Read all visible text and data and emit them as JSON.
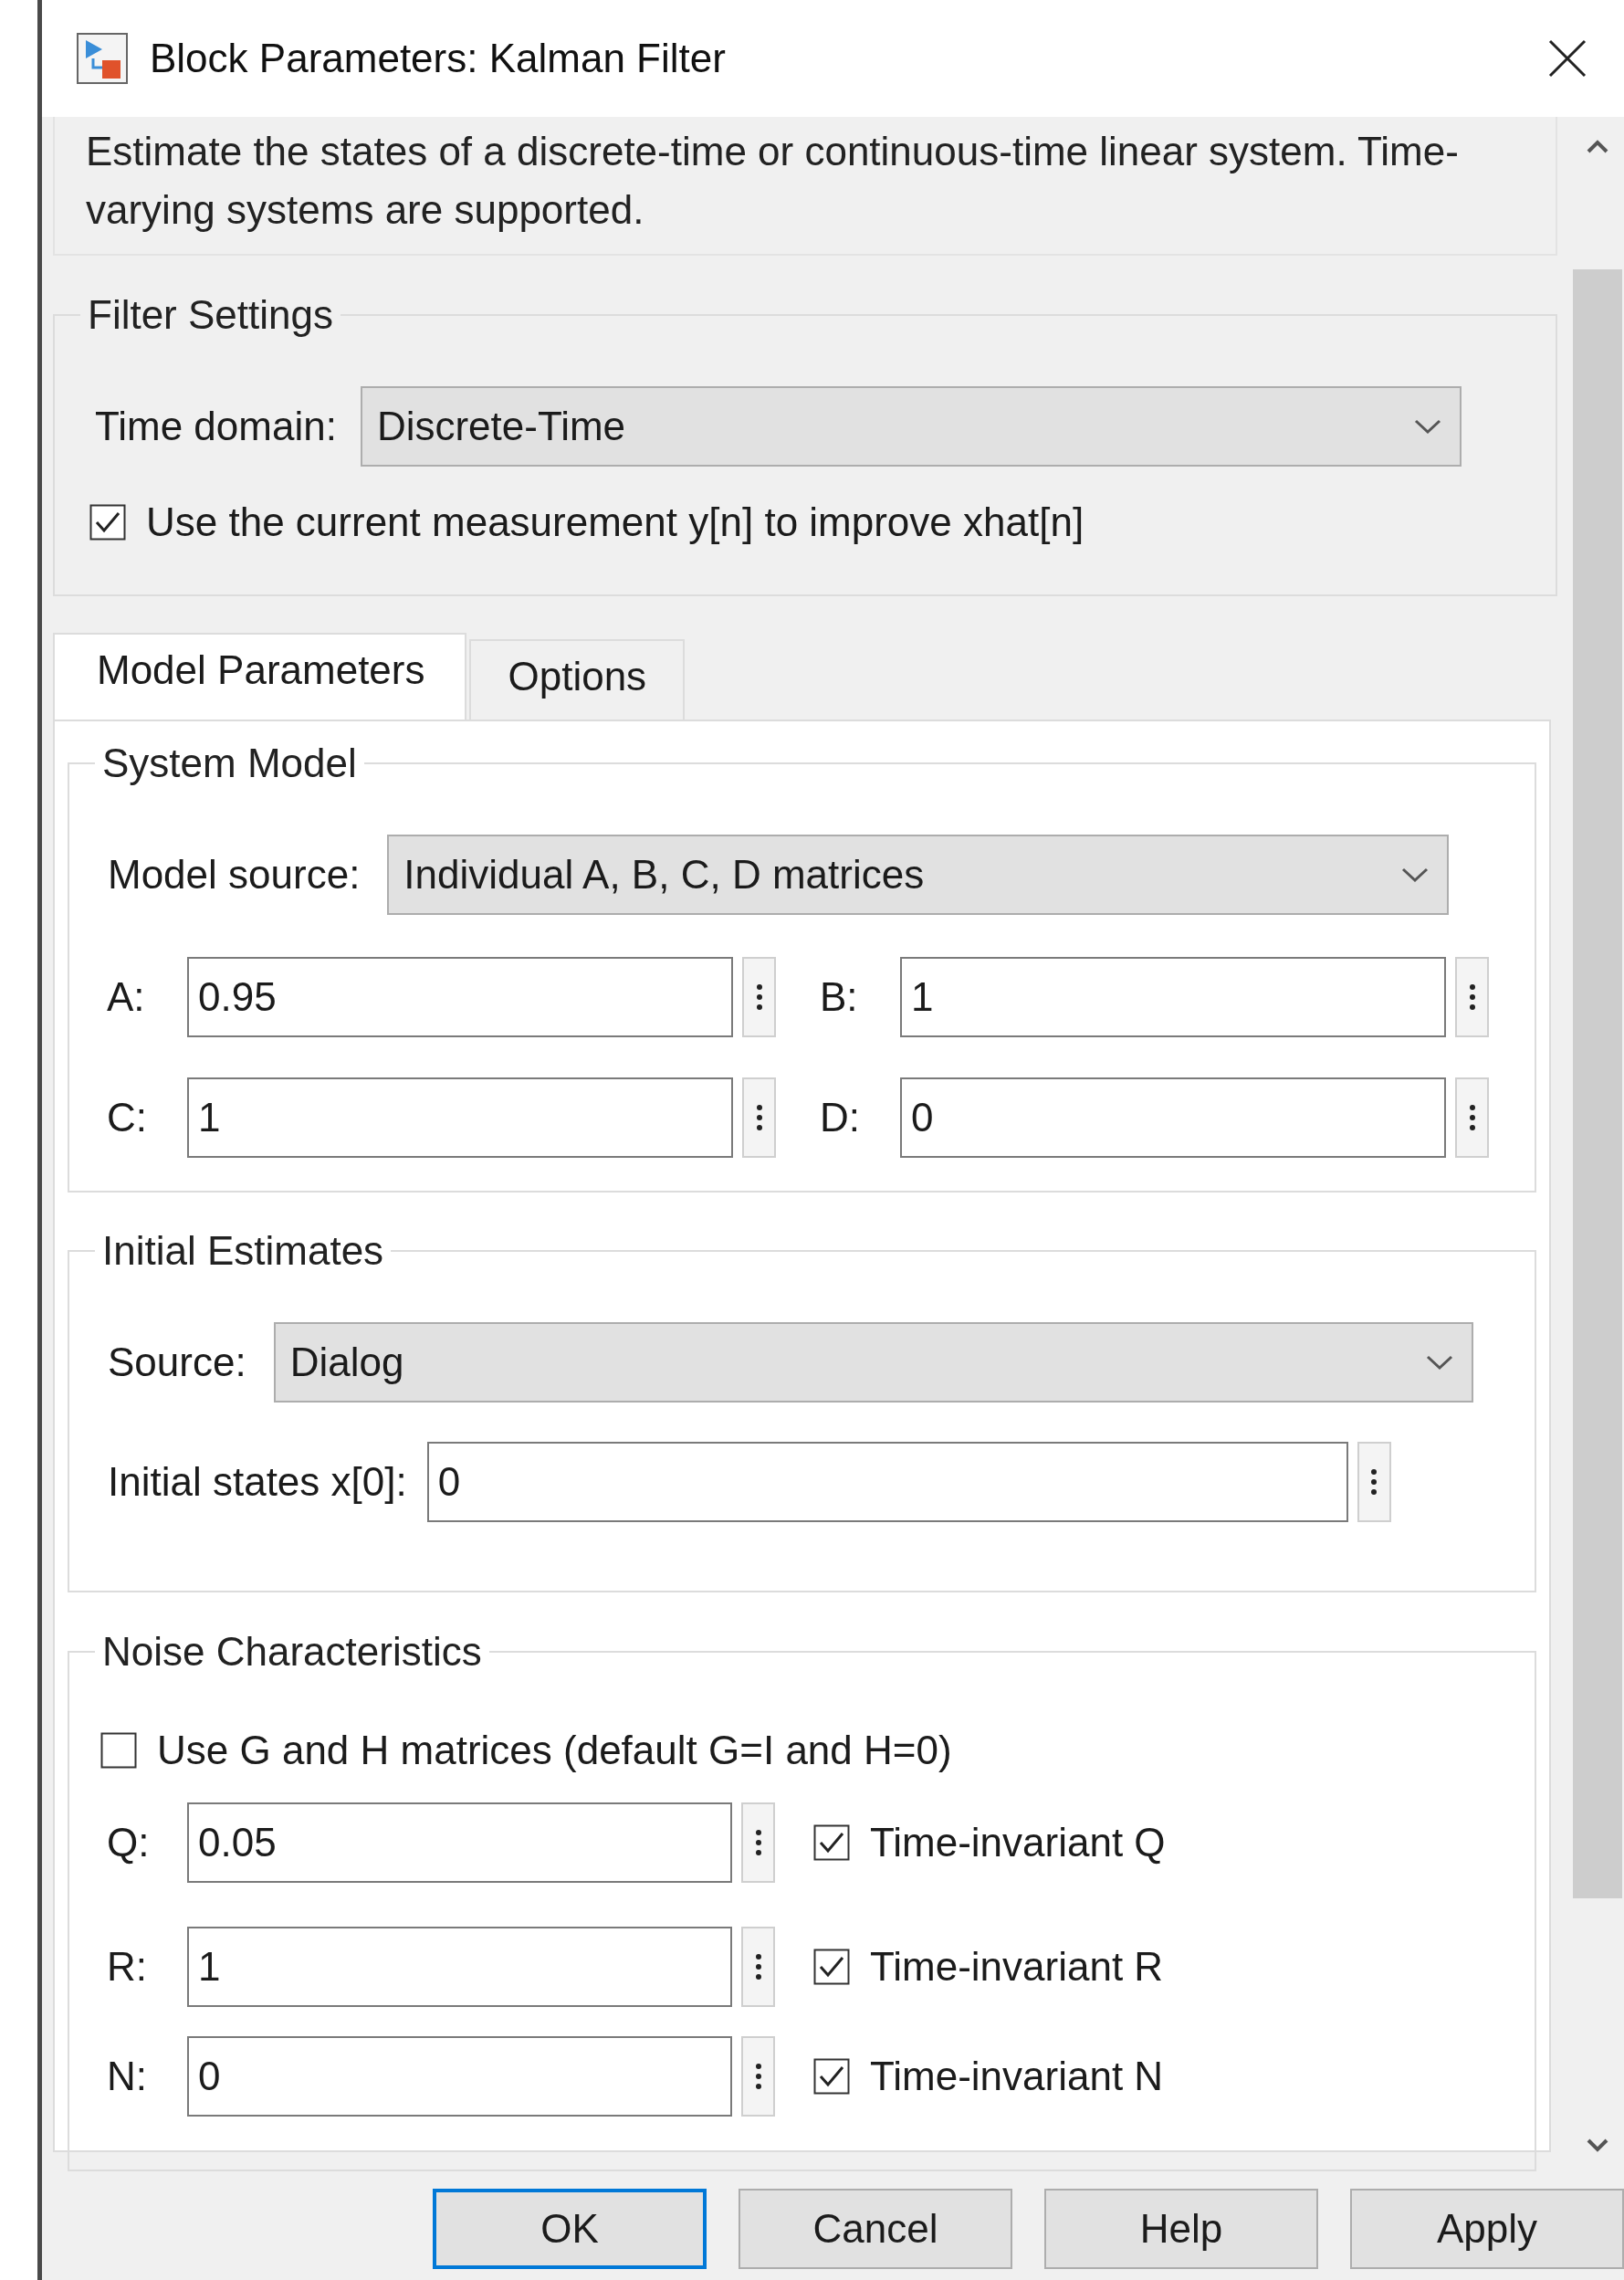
{
  "window": {
    "title": "Block Parameters: Kalman Filter"
  },
  "description": "Estimate the states of a discrete-time or continuous-time linear system. Time-varying systems are supported.",
  "filter_settings": {
    "title": "Filter Settings",
    "time_domain": {
      "label": "Time domain:",
      "value": "Discrete-Time"
    },
    "use_current_measurement": {
      "label": "Use the current measurement y[n] to improve xhat[n]",
      "checked": true
    }
  },
  "tabs": [
    {
      "label": "Model Parameters",
      "selected": true
    },
    {
      "label": "Options",
      "selected": false
    }
  ],
  "system_model": {
    "title": "System Model",
    "model_source": {
      "label": "Model source:",
      "value": "Individual A, B, C, D matrices"
    },
    "matrices": [
      {
        "label": "A:",
        "value": "0.95"
      },
      {
        "label": "B:",
        "value": "1"
      },
      {
        "label": "C:",
        "value": "1"
      },
      {
        "label": "D:",
        "value": "0"
      }
    ]
  },
  "initial_estimates": {
    "title": "Initial Estimates",
    "source": {
      "label": "Source:",
      "value": "Dialog"
    },
    "initial_states": {
      "label": "Initial states x[0]:",
      "value": "0"
    }
  },
  "noise_characteristics": {
    "title": "Noise Characteristics",
    "use_g_and_h": {
      "label": "Use G and H matrices (default G=I and H=0)",
      "checked": false
    },
    "rows": [
      {
        "label": "Q:",
        "value": "0.05",
        "time_invariant": {
          "label": "Time-invariant Q",
          "checked": true
        }
      },
      {
        "label": "R:",
        "value": "1",
        "time_invariant": {
          "label": "Time-invariant R",
          "checked": true
        }
      },
      {
        "label": "N:",
        "value": "0",
        "time_invariant": {
          "label": "Time-invariant N",
          "checked": true
        }
      }
    ]
  },
  "buttons": [
    {
      "label": "OK",
      "focused": true
    },
    {
      "label": "Cancel",
      "focused": false
    },
    {
      "label": "Help",
      "focused": false
    },
    {
      "label": "Apply",
      "focused": false
    }
  ]
}
